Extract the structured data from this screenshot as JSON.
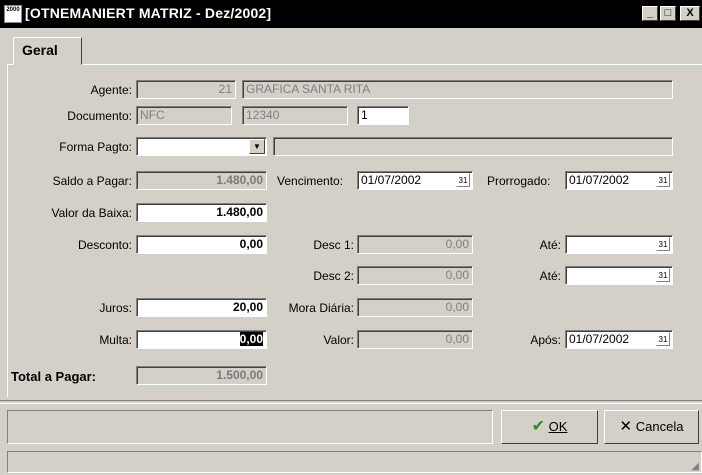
{
  "window": {
    "app_icon_text": "2000",
    "title": "[OTNEMANIERT MATRIZ - Dez/2002]",
    "minimize": "_",
    "maximize": "□",
    "close": "X"
  },
  "tabs": [
    {
      "label": "Geral"
    }
  ],
  "form": {
    "agente": {
      "label": "Agente:",
      "code": "21",
      "name": "GRAFICA SANTA RITA"
    },
    "documento": {
      "label": "Documento:",
      "tipo": "NFC",
      "numero": "12340",
      "parcela": "1"
    },
    "forma_pagto": {
      "label": "Forma Pagto:",
      "value": "",
      "extra": ""
    },
    "saldo_pagar": {
      "label": "Saldo a Pagar:",
      "value": "1.480,00"
    },
    "vencimento": {
      "label": "Vencimento:",
      "value": "01/07/2002"
    },
    "prorrogado": {
      "label": "Prorrogado:",
      "value": "01/07/2002"
    },
    "valor_baixa": {
      "label": "Valor da Baixa:",
      "value": "1.480,00"
    },
    "desconto": {
      "label": "Desconto:",
      "value": "0,00"
    },
    "desc1": {
      "label": "Desc 1:",
      "value": "0,00"
    },
    "desc2": {
      "label": "Desc 2:",
      "value": "0,00"
    },
    "ate1": {
      "label": "Até:",
      "value": ""
    },
    "ate2": {
      "label": "Até:",
      "value": ""
    },
    "juros": {
      "label": "Juros:",
      "value": "20,00"
    },
    "mora_diaria": {
      "label": "Mora Diária:",
      "value": "0,00"
    },
    "multa": {
      "label": "Multa:",
      "value": "0,00"
    },
    "valor": {
      "label": "Valor:",
      "value": "0,00"
    },
    "apos": {
      "label": "Após:",
      "value": "01/07/2002"
    },
    "total_pagar": {
      "label": "Total a Pagar:",
      "value": "1.500,00"
    }
  },
  "calendar_icon": "calendar-icon",
  "buttons": {
    "ok": {
      "check": "✔",
      "label": "OK"
    },
    "cancela": {
      "x": "✕",
      "label": "Cancela"
    }
  },
  "colors": {
    "titlebar": "#000000",
    "face": "#d4d0c8",
    "field": "#ffffff",
    "check": "#2a8a2a"
  }
}
